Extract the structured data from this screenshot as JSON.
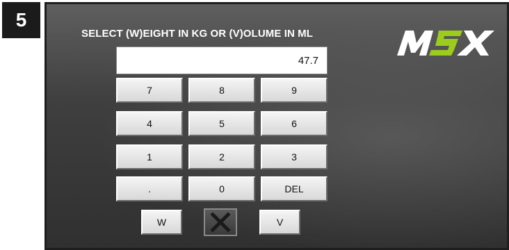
{
  "step": {
    "number": "5"
  },
  "screen": {
    "prompt": "SELECT (W)EIGHT IN KG OR (V)OLUME IN ML",
    "display_value": "47.7",
    "logo": {
      "text": "MSX",
      "icon": "msx-logo",
      "colors": {
        "main": "#ffffff",
        "accent": "#9ccc1c"
      }
    }
  },
  "keypad": {
    "keys": [
      "7",
      "8",
      "9",
      "4",
      "5",
      "6",
      "1",
      "2",
      "3",
      ".",
      "0",
      "DEL"
    ]
  },
  "mode": {
    "weight_label": "W",
    "volume_label": "V",
    "cancel_icon": "close-icon"
  },
  "colors": {
    "panel_dark": "#303030",
    "key_face": "#e4e4e4",
    "text_on_panel": "#ffffff"
  }
}
